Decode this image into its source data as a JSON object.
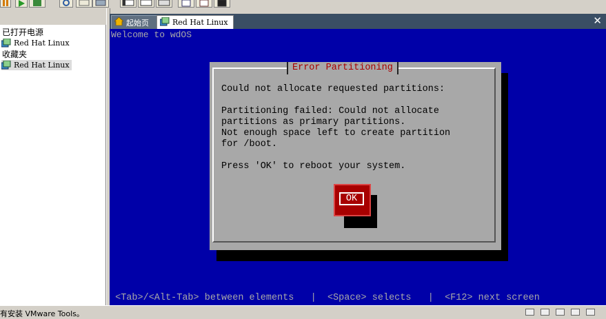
{
  "sidebar": {
    "powered_on_heading": "已打开电源",
    "favorites_heading": "收藏夹",
    "items": [
      {
        "label": "Red Hat Linux",
        "icon": "vm-icon"
      },
      {
        "label": "Red Hat Linux",
        "icon": "vm-icon"
      }
    ]
  },
  "tabs": [
    {
      "label": "起始页",
      "icon": "home-icon"
    },
    {
      "label": "Red Hat Linux",
      "icon": "vm-icon"
    }
  ],
  "console": {
    "welcome": "Welcome to wdOS",
    "dialog": {
      "title": "Error Partitioning",
      "line1": "Could not allocate requested partitions:",
      "line2": "Partitioning failed: Could not allocate\npartitions as primary partitions.\nNot enough space left to create partition\nfor /boot.",
      "line3": "Press 'OK' to reboot your system.",
      "ok_label": "OK"
    },
    "help_line": " <Tab>/<Alt-Tab> between elements   |  <Space> selects   |  <F12> next screen"
  },
  "status_bar": {
    "text": "有安装 VMware Tools。"
  },
  "colors": {
    "console_bg": "#0000a8",
    "dialog_bg": "#a8a8a8",
    "title_red": "#a80000",
    "tab_bar": "#3a4e64"
  }
}
